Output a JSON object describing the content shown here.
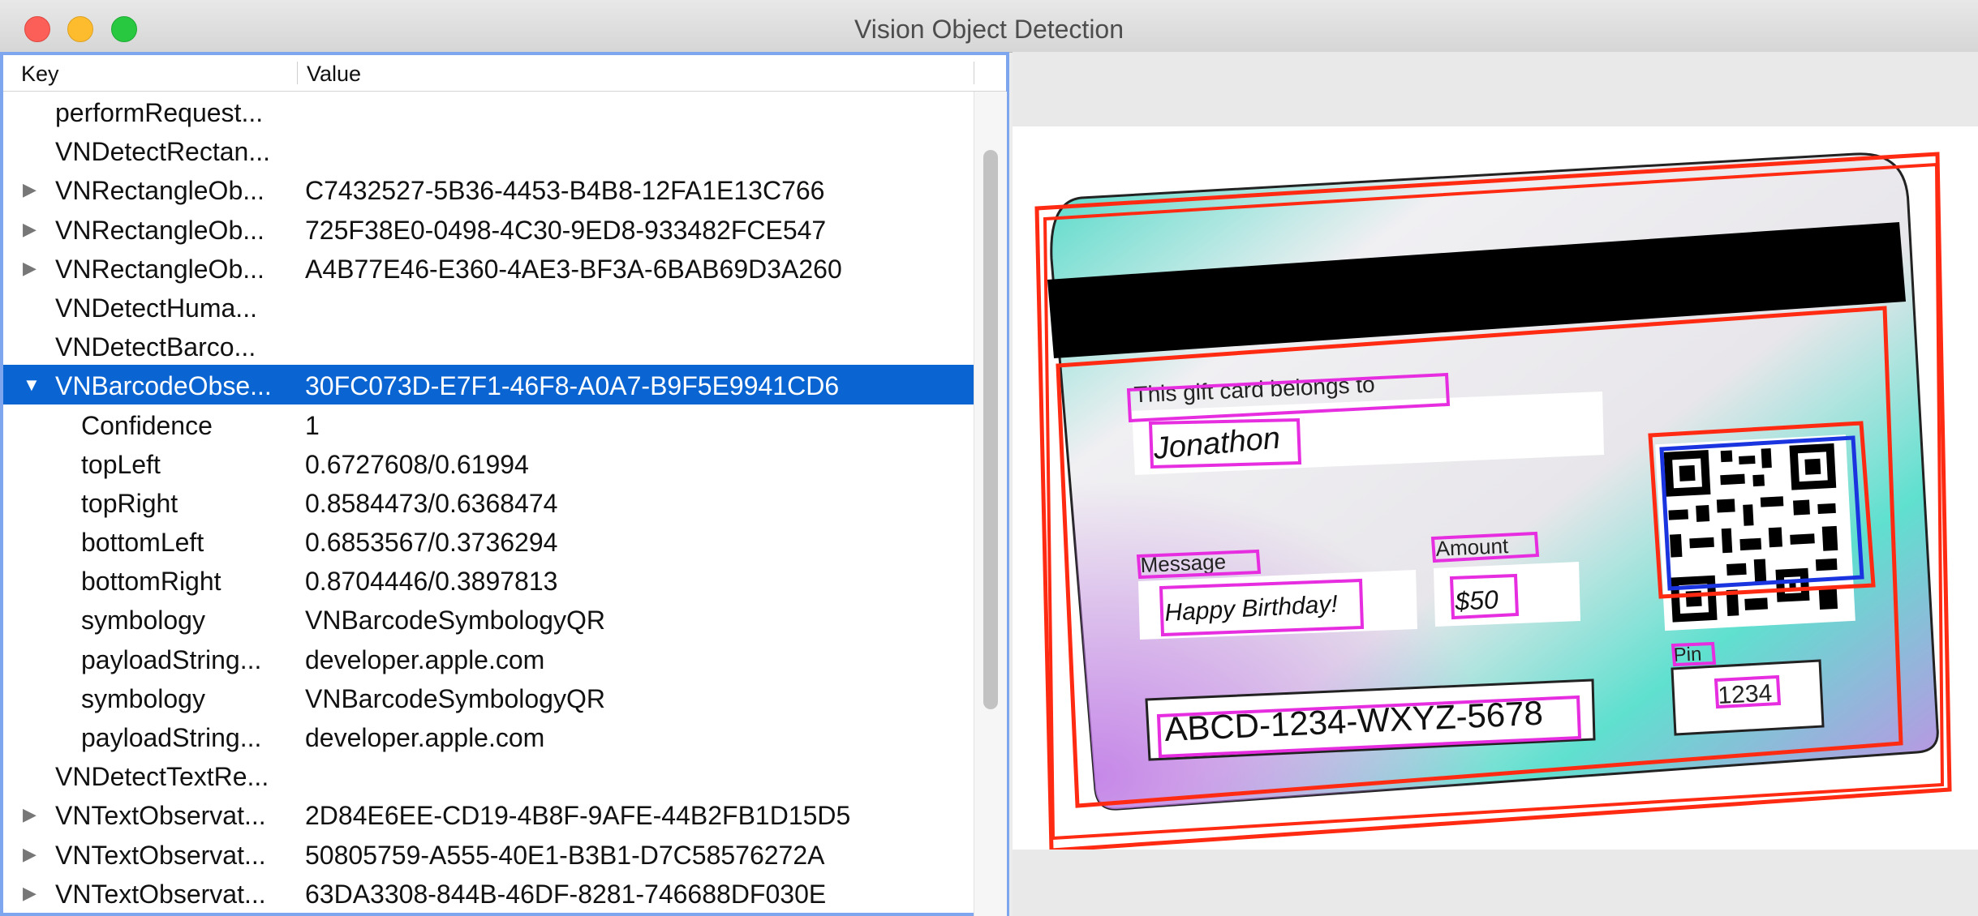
{
  "window": {
    "title": "Vision Object Detection"
  },
  "table": {
    "headers": {
      "key": "Key",
      "value": "Value"
    },
    "rows": [
      {
        "key": "performRequest...",
        "value": "",
        "level": 0,
        "disclosure": "",
        "selected": false
      },
      {
        "key": "VNDetectRectan...",
        "value": "",
        "level": 0,
        "disclosure": "",
        "selected": false
      },
      {
        "key": "VNRectangleOb...",
        "value": "C7432527-5B36-4453-B4B8-12FA1E13C766",
        "level": 0,
        "disclosure": "▶",
        "selected": false
      },
      {
        "key": "VNRectangleOb...",
        "value": "725F38E0-0498-4C30-9ED8-933482FCE547",
        "level": 0,
        "disclosure": "▶",
        "selected": false
      },
      {
        "key": "VNRectangleOb...",
        "value": "A4B77E46-E360-4AE3-BF3A-6BAB69D3A260",
        "level": 0,
        "disclosure": "▶",
        "selected": false
      },
      {
        "key": "VNDetectHuma...",
        "value": "",
        "level": 0,
        "disclosure": "",
        "selected": false
      },
      {
        "key": "VNDetectBarco...",
        "value": "",
        "level": 0,
        "disclosure": "",
        "selected": false
      },
      {
        "key": "VNBarcodeObse...",
        "value": "30FC073D-E7F1-46F8-A0A7-B9F5E9941CD6",
        "level": 0,
        "disclosure": "▼",
        "selected": true
      },
      {
        "key": "Confidence",
        "value": "1",
        "level": 1,
        "disclosure": "",
        "selected": false
      },
      {
        "key": "topLeft",
        "value": "0.6727608/0.61994",
        "level": 1,
        "disclosure": "",
        "selected": false
      },
      {
        "key": "topRight",
        "value": "0.8584473/0.6368474",
        "level": 1,
        "disclosure": "",
        "selected": false
      },
      {
        "key": "bottomLeft",
        "value": "0.6853567/0.3736294",
        "level": 1,
        "disclosure": "",
        "selected": false
      },
      {
        "key": "bottomRight",
        "value": "0.8704446/0.3897813",
        "level": 1,
        "disclosure": "",
        "selected": false
      },
      {
        "key": "symbology",
        "value": "VNBarcodeSymbologyQR",
        "level": 1,
        "disclosure": "",
        "selected": false
      },
      {
        "key": "payloadString...",
        "value": "developer.apple.com",
        "level": 1,
        "disclosure": "",
        "selected": false
      },
      {
        "key": "symbology",
        "value": "VNBarcodeSymbologyQR",
        "level": 1,
        "disclosure": "",
        "selected": false
      },
      {
        "key": "payloadString...",
        "value": "developer.apple.com",
        "level": 1,
        "disclosure": "",
        "selected": false
      },
      {
        "key": "VNDetectTextRe...",
        "value": "",
        "level": 0,
        "disclosure": "",
        "selected": false
      },
      {
        "key": "VNTextObservat...",
        "value": "2D84E6EE-CD19-4B8F-9AFE-44B2FB1D15D5",
        "level": 0,
        "disclosure": "▶",
        "selected": false
      },
      {
        "key": "VNTextObservat...",
        "value": "50805759-A555-40E1-B3B1-D7C58576272A",
        "level": 0,
        "disclosure": "▶",
        "selected": false
      },
      {
        "key": "VNTextObservat...",
        "value": "63DA3308-844B-46DF-8281-746688DF030E",
        "level": 0,
        "disclosure": "▶",
        "selected": false
      }
    ]
  },
  "card": {
    "belongs_label": "This gift card belongs to",
    "name": "Jonathon",
    "message_label": "Message",
    "message": "Happy Birthday!",
    "amount_label": "Amount",
    "amount": "$50",
    "pin_label": "Pin",
    "pin": "1234",
    "code": "ABCD-1234-WXYZ-5678"
  },
  "colors": {
    "rect_box": "#ff2a12",
    "text_box": "#e62ee0",
    "barcode_box": "#1a35e0",
    "selection": "#0a64d2",
    "focus_ring": "#7ea6ef"
  }
}
